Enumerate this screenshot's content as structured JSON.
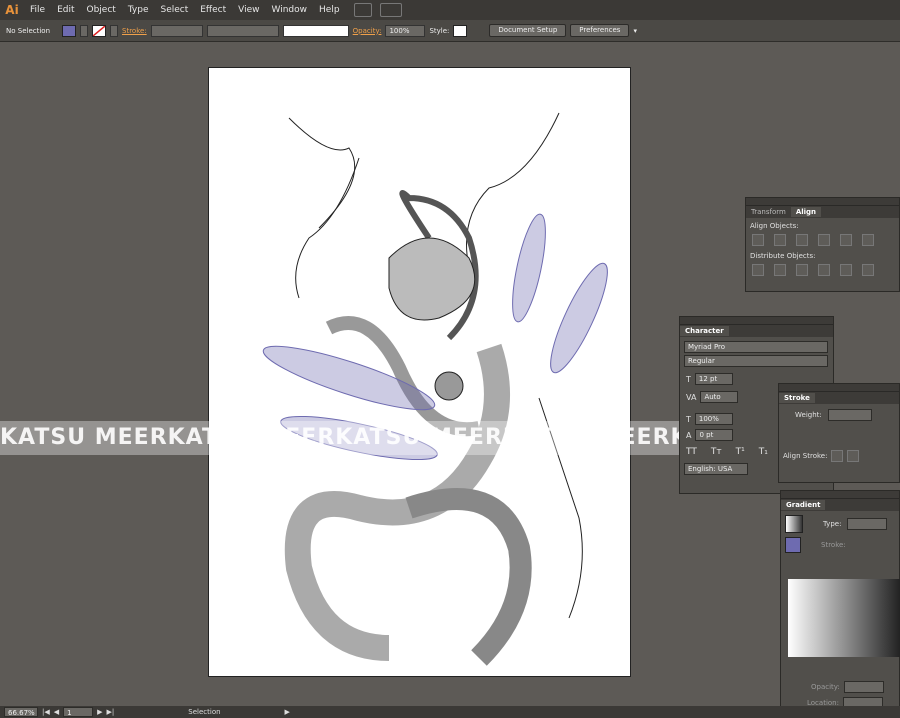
{
  "app": {
    "logo": "Ai"
  },
  "menubar": {
    "items": [
      "File",
      "Edit",
      "Object",
      "Type",
      "Select",
      "Effect",
      "View",
      "Window",
      "Help"
    ]
  },
  "control": {
    "selection_label": "No Selection",
    "stroke_label": "Stroke:",
    "opacity_label": "Opacity:",
    "opacity_value": "100%",
    "style_label": "Style:",
    "document_setup": "Document Setup",
    "preferences": "Preferences",
    "fill_color": "#6e6bb0"
  },
  "watermark": {
    "text": "KATSU MEERKATSU MEERKATSU MEERKATSU MEERKATSU MEERKATSU ME"
  },
  "align_panel": {
    "tab_transform": "Transform",
    "tab_align": "Align",
    "align_objects": "Align Objects:",
    "distribute_objects": "Distribute Objects:"
  },
  "character_panel": {
    "title": "Character",
    "font": "Myriad Pro",
    "style": "Regular",
    "size": "12 pt",
    "tracking": "Auto",
    "scale": "100%",
    "baseline": "0 pt",
    "language": "English: USA"
  },
  "stroke_panel": {
    "title": "Stroke",
    "weight_label": "Weight:",
    "align_stroke": "Align Stroke:"
  },
  "gradient_panel": {
    "title": "Gradient",
    "type_label": "Type:",
    "stroke_label": "Stroke:",
    "opacity_label": "Opacity:",
    "location_label": "Location:"
  },
  "status": {
    "zoom": "66.67%",
    "page": "1",
    "tool": "Selection"
  }
}
